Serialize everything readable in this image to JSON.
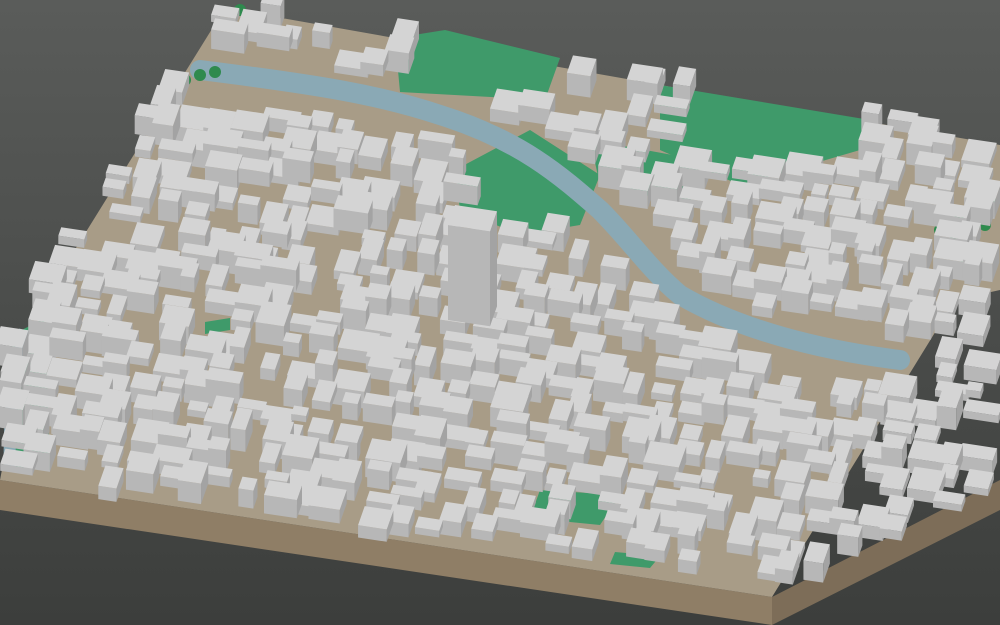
{
  "scene": {
    "type": "3d-city-model",
    "view": "oblique-aerial",
    "colors": {
      "background_top": "#5a5c5a",
      "background_bottom": "#3c3e3c",
      "ground": "#a89c87",
      "base_front": "#8f7e66",
      "base_side": "#7d6d58",
      "building_top": "#d4d4d4",
      "building_side": "#b7b7b7",
      "building_shadow": "#a3a3a3",
      "park": "#3f9a6a",
      "river": "#8aa9b5",
      "road": "#c9c9c9",
      "tree": "#2f8a4e"
    }
  }
}
